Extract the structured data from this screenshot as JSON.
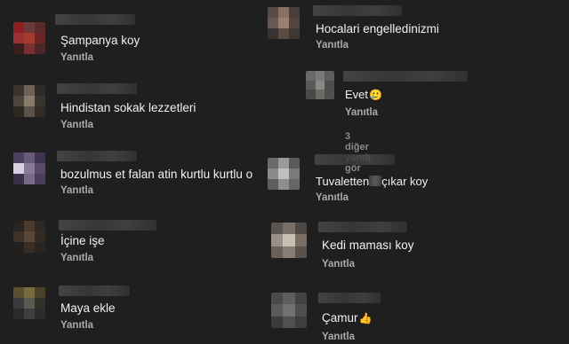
{
  "comments": [
    {
      "text": "Şampanya koy",
      "reply": "Yanıtla"
    },
    {
      "text": "Hindistan sokak lezzetleri",
      "reply": "Yanıtla"
    },
    {
      "text": "bozulmus et falan atin kurtlu kurtlu o",
      "reply": "Yanıtla"
    },
    {
      "text": "İçine işe",
      "reply": "Yanıtla"
    },
    {
      "text": "Maya ekle",
      "reply": "Yanıtla"
    },
    {
      "text": "Hocalari engelledinizmi",
      "reply": "Yanıtla"
    },
    {
      "text": "Evet",
      "emoji": "🥲",
      "reply": "Yanıtla",
      "more_replies": "3 diğer yanıtı gör"
    },
    {
      "text_before": "Tuvaletten",
      "text_after": "çıkar koy",
      "reply": "Yanıtla"
    },
    {
      "text": "Kedi maması koy",
      "reply": "Yanıtla"
    },
    {
      "text": "Çamur",
      "emoji": "👍",
      "reply": "Yanıtla"
    }
  ],
  "icons": {
    "blurred_avatar": "blurred-avatar-icon",
    "reaction_emoji": "emoji-icon"
  }
}
